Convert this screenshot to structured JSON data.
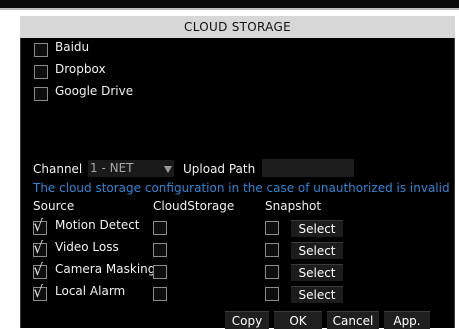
{
  "window": {
    "title": "CLOUD STORAGE"
  },
  "providers": [
    {
      "label": "Baidu",
      "checked": false
    },
    {
      "label": "Dropbox",
      "checked": false
    },
    {
      "label": "Google Drive",
      "checked": false
    }
  ],
  "channel": {
    "label": "Channel",
    "value": "1 - NET",
    "upload_path_label": "Upload Path",
    "upload_path_value": ""
  },
  "warning": "The cloud storage configuration in the case of unauthorized is invalid",
  "table": {
    "headers": {
      "source": "Source",
      "cloud": "CloudStorage",
      "snapshot": "Snapshot"
    },
    "rows": [
      {
        "source": "Motion Detect",
        "source_checked": true,
        "cloud_checked": false,
        "snapshot_checked": false,
        "select_label": "Select"
      },
      {
        "source": "Video Loss",
        "source_checked": true,
        "cloud_checked": false,
        "snapshot_checked": false,
        "select_label": "Select"
      },
      {
        "source": "Camera Masking",
        "source_checked": true,
        "cloud_checked": false,
        "snapshot_checked": false,
        "select_label": "Select"
      },
      {
        "source": "Local Alarm",
        "source_checked": true,
        "cloud_checked": false,
        "snapshot_checked": false,
        "select_label": "Select"
      }
    ]
  },
  "footer": {
    "copy": "Copy",
    "ok": "OK",
    "cancel": "Cancel",
    "apply": "App."
  },
  "colors": {
    "panel_bg": "#000000",
    "title_bg": "#d7d7d7",
    "warning": "#2f86d6"
  }
}
